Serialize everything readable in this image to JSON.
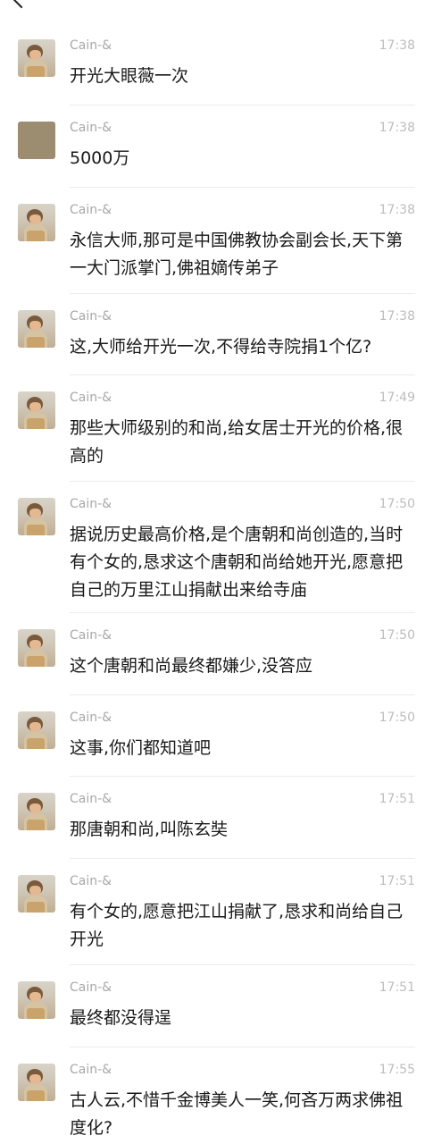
{
  "messages": [
    {
      "sender": "Cain-&",
      "time": "17:38",
      "text": "开光大眼薇一次",
      "avatar": "child-photo"
    },
    {
      "sender": "Cain-&",
      "time": "17:38",
      "text": "5000万",
      "avatar": "plain-brown"
    },
    {
      "sender": "Cain-&",
      "time": "17:38",
      "text": "永信大师,那可是中国佛教协会副会长,天下第一大门派掌门,佛祖嫡传弟子",
      "avatar": "child-photo"
    },
    {
      "sender": "Cain-&",
      "time": "17:38",
      "text": "这,大师给开光一次,不得给寺院捐1个亿?",
      "avatar": "child-photo"
    },
    {
      "sender": "Cain-&",
      "time": "17:49",
      "text": "那些大师级别的和尚,给女居士开光的价格,很高的",
      "avatar": "child-photo"
    },
    {
      "sender": "Cain-&",
      "time": "17:50",
      "text": "据说历史最高价格,是个唐朝和尚创造的,当时有个女的,恳求这个唐朝和尚给她开光,愿意把自己的万里江山捐献出来给寺庙",
      "avatar": "child-photo"
    },
    {
      "sender": "Cain-&",
      "time": "17:50",
      "text": "这个唐朝和尚最终都嫌少,没答应",
      "avatar": "child-photo"
    },
    {
      "sender": "Cain-&",
      "time": "17:50",
      "text": "这事,你们都知道吧",
      "avatar": "child-photo"
    },
    {
      "sender": "Cain-&",
      "time": "17:51",
      "text": "那唐朝和尚,叫陈玄奘",
      "avatar": "child-photo"
    },
    {
      "sender": "Cain-&",
      "time": "17:51",
      "text": "有个女的,愿意把江山捐献了,恳求和尚给自己开光",
      "avatar": "child-photo"
    },
    {
      "sender": "Cain-&",
      "time": "17:51",
      "text": "最终都没得逞",
      "avatar": "child-photo"
    },
    {
      "sender": "Cain-&",
      "time": "17:55",
      "text": "古人云,不惜千金博美人一笑,何吝万两求佛祖度化?",
      "avatar": "child-photo"
    }
  ]
}
